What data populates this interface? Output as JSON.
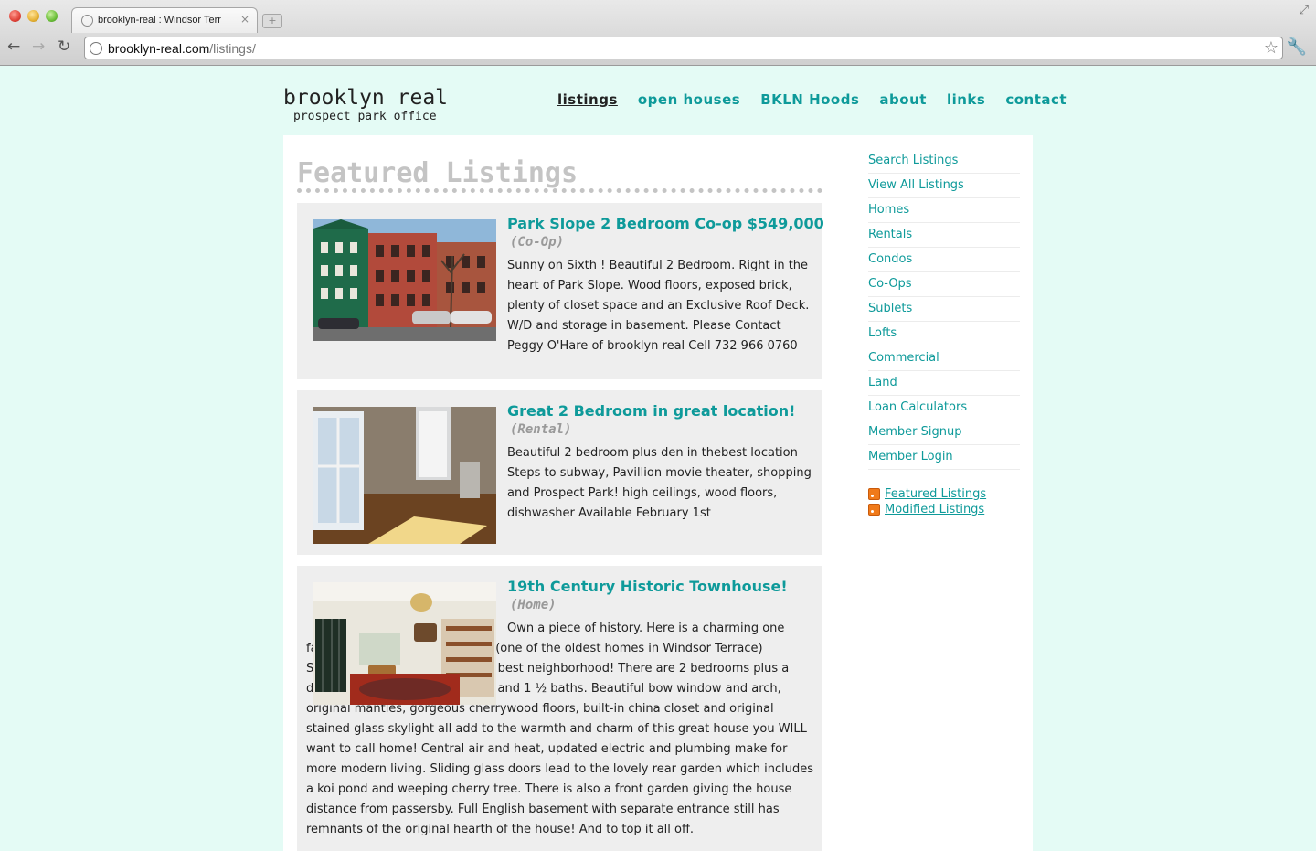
{
  "browser": {
    "tab_title": "brooklyn-real : Windsor Terr",
    "tab_close": "×",
    "new_tab": "+",
    "url_host": "brooklyn-real.com",
    "url_path": "/listings/"
  },
  "site": {
    "logo_main": "brooklyn real",
    "logo_sub": "prospect park office"
  },
  "nav": [
    {
      "label": "listings"
    },
    {
      "label": "open houses"
    },
    {
      "label": "BKLN Hoods"
    },
    {
      "label": "about"
    },
    {
      "label": "links"
    },
    {
      "label": "contact"
    }
  ],
  "main": {
    "heading": "Featured Listings",
    "listings": [
      {
        "title": "Park Slope 2 Bedroom Co-op $549,000",
        "kind": "(Co-Op)",
        "description": "Sunny on Sixth ! Beautiful 2 Bedroom. Right in the heart of Park Slope. Wood floors, exposed brick, plenty of closet space and an Exclusive Roof Deck. W/D and storage in basement. Please Contact Peggy O'Hare of brooklyn real Cell 732 966 0760"
      },
      {
        "title": "Great 2 Bedroom in great location!",
        "kind": "(Rental)",
        "description": "Beautiful 2 bedroom plus den in thebest location Steps to subway, Pavillion movie theater, shopping and Prospect Park! high ceilings, wood floors, dishwasher Available February 1st"
      },
      {
        "title": "19th Century Historic Townhouse!",
        "kind": "(Home)",
        "description": "Own a piece of history. Here is a charming one family home built in the 1870's (one of the oldest homes in Windsor Terrace) Situated on a great block in the best neighborhood! There are 2 bedrooms plus a den (can be used as a third BR) and 1 ½ baths. Beautiful bow window and arch, original mantles, gorgeous cherrywood floors, built-in china closet and original stained glass skylight all add to the warmth and charm of this great house you WILL want to call home! Central air and heat, updated electric and plumbing make for more modern living. Sliding glass doors lead to the lovely rear garden which includes a koi pond and weeping cherry tree. There is also a front garden giving the house distance from passersby. Full English basement with separate entrance still has remnants of the original hearth of the house! And to top it all off."
      }
    ]
  },
  "sidebar": {
    "links": [
      "Search Listings",
      "View All Listings",
      "Homes",
      "Rentals",
      "Condos",
      "Co-Ops",
      "Sublets",
      "Lofts",
      "Commercial",
      "Land",
      "Loan Calculators",
      "Member Signup",
      "Member Login"
    ],
    "feeds": [
      "Featured Listings",
      "Modified Listings"
    ]
  }
}
